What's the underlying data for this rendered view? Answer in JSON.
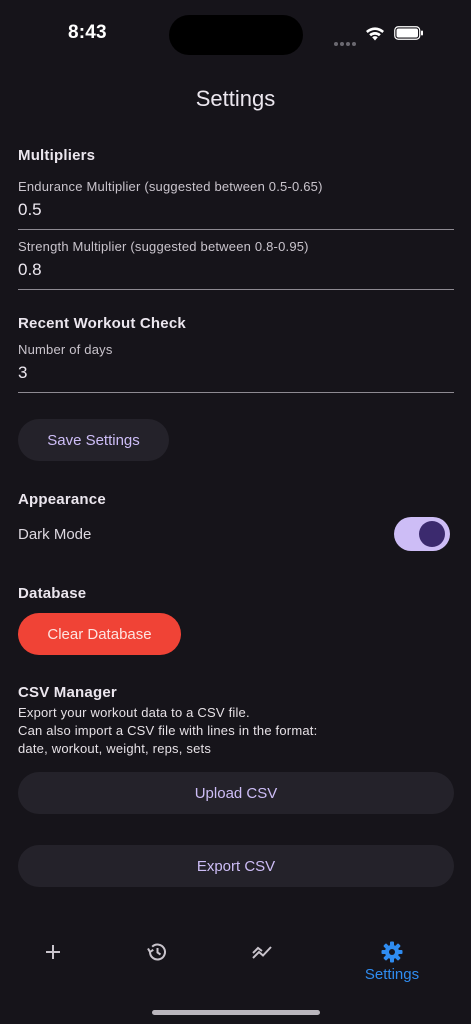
{
  "status_bar": {
    "time": "8:43"
  },
  "header": {
    "title": "Settings"
  },
  "multipliers": {
    "title": "Multipliers",
    "endurance_label": "Endurance Multiplier (suggested between 0.5-0.65)",
    "endurance_value": "0.5",
    "strength_label": "Strength Multiplier (suggested between 0.8-0.95)",
    "strength_value": "0.8"
  },
  "recent_check": {
    "title": "Recent Workout Check",
    "days_label": "Number of days",
    "days_value": "3"
  },
  "save_button_label": "Save Settings",
  "appearance": {
    "title": "Appearance",
    "dark_mode_label": "Dark Mode",
    "dark_mode_on": true
  },
  "database": {
    "title": "Database",
    "clear_label": "Clear Database"
  },
  "csv": {
    "title": "CSV Manager",
    "desc_line1": "Export your workout data to a CSV file.",
    "desc_line2": "Can also import a CSV file with lines in the format:",
    "desc_line3": "date, workout, weight, reps, sets",
    "upload_label": "Upload CSV",
    "export_label": "Export CSV"
  },
  "bottom_nav": {
    "items": [
      {
        "icon": "plus-icon",
        "label": ""
      },
      {
        "icon": "history-icon",
        "label": ""
      },
      {
        "icon": "trend-chart-icon",
        "label": ""
      },
      {
        "icon": "gear-icon",
        "label": "Settings",
        "active": true
      }
    ]
  },
  "colors": {
    "background": "#16141a",
    "accent": "#cdbdf6",
    "danger": "#f04336",
    "nav_active": "#2f8cf0"
  }
}
